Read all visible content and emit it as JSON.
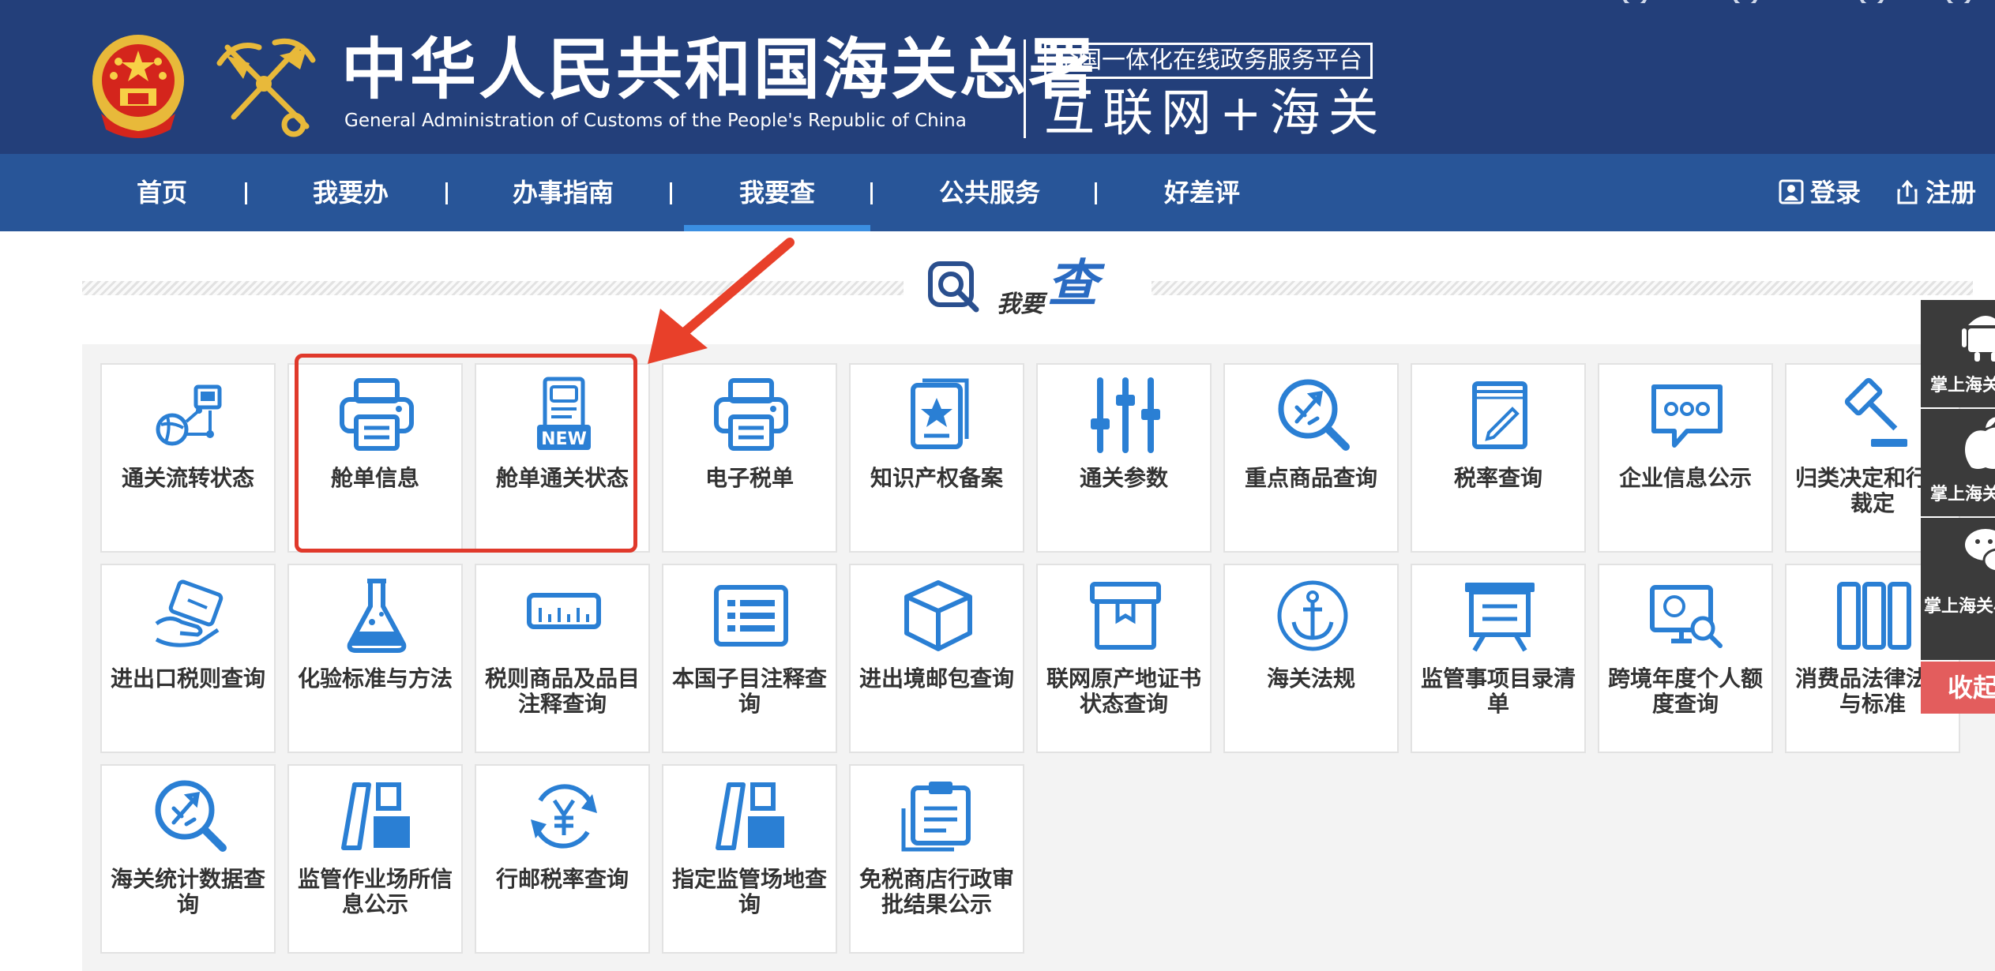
{
  "header": {
    "title_cn": "中华人民共和国海关总署",
    "title_en": "General Administration of Customs of the People's Republic of China",
    "platform_name": "全国一体化在线政务服务平台",
    "platform_slogan": "互联网+海关"
  },
  "nav": {
    "items": [
      {
        "label": "首页"
      },
      {
        "label": "我要办"
      },
      {
        "label": "办事指南"
      },
      {
        "label": "我要查",
        "active": true
      },
      {
        "label": "公共服务"
      },
      {
        "label": "好差评"
      }
    ],
    "login_label": "登录",
    "register_label": "注册"
  },
  "section": {
    "title_small": "我要",
    "title_big": "查"
  },
  "cards": [
    {
      "label": "通关流转状态",
      "icon": "flow-network-icon"
    },
    {
      "label": "舱单信息",
      "icon": "printer-icon"
    },
    {
      "label": "舱单通关状态",
      "icon": "new-document-icon"
    },
    {
      "label": "电子税单",
      "icon": "printer-icon"
    },
    {
      "label": "知识产权备案",
      "icon": "star-certificate-icon"
    },
    {
      "label": "通关参数",
      "icon": "sliders-icon"
    },
    {
      "label": "重点商品查询",
      "icon": "magnifier-rocket-icon"
    },
    {
      "label": "税率查询",
      "icon": "book-pen-icon"
    },
    {
      "label": "企业信息公示",
      "icon": "chat-bubble-icon"
    },
    {
      "label": "归类决定和行政裁定",
      "icon": "gavel-icon"
    },
    {
      "label": "进出口税则查询",
      "icon": "card-hand-icon"
    },
    {
      "label": "化验标准与方法",
      "icon": "flask-icon"
    },
    {
      "label": "税则商品及品目注释查询",
      "icon": "ruler-icon"
    },
    {
      "label": "本国子目注释查询",
      "icon": "list-card-icon"
    },
    {
      "label": "进出境邮包查询",
      "icon": "package-icon"
    },
    {
      "label": "联网原产地证书状态查询",
      "icon": "box-open-icon"
    },
    {
      "label": "海关法规",
      "icon": "anchor-icon"
    },
    {
      "label": "监管事项目录清单",
      "icon": "easel-icon"
    },
    {
      "label": "跨境年度个人额度查询",
      "icon": "monitor-search-icon"
    },
    {
      "label": "消费品法律法规与标准",
      "icon": "columns-icon"
    },
    {
      "label": "海关统计数据查询",
      "icon": "magnifier-rocket-icon"
    },
    {
      "label": "监管作业场所信息公示",
      "icon": "panels-icon"
    },
    {
      "label": "行邮税率查询",
      "icon": "yen-cycle-icon"
    },
    {
      "label": "指定监管场地查询",
      "icon": "panels-icon"
    },
    {
      "label": "免税商店行政审批结果公示",
      "icon": "clipboard-icon"
    }
  ],
  "float_bar": {
    "items": [
      {
        "label": "掌上海关",
        "icon": "android-icon"
      },
      {
        "label": "掌上海关",
        "icon": "apple-icon"
      },
      {
        "label": "掌上海关小程序",
        "icon": "wechat-icon"
      }
    ],
    "collapse_label": "收起"
  },
  "colors": {
    "header_bg": "#233f7a",
    "nav_bg": "#285598",
    "accent": "#3b8fe2",
    "icon_blue": "#2a7fd4",
    "highlight_red": "#e0392b"
  }
}
